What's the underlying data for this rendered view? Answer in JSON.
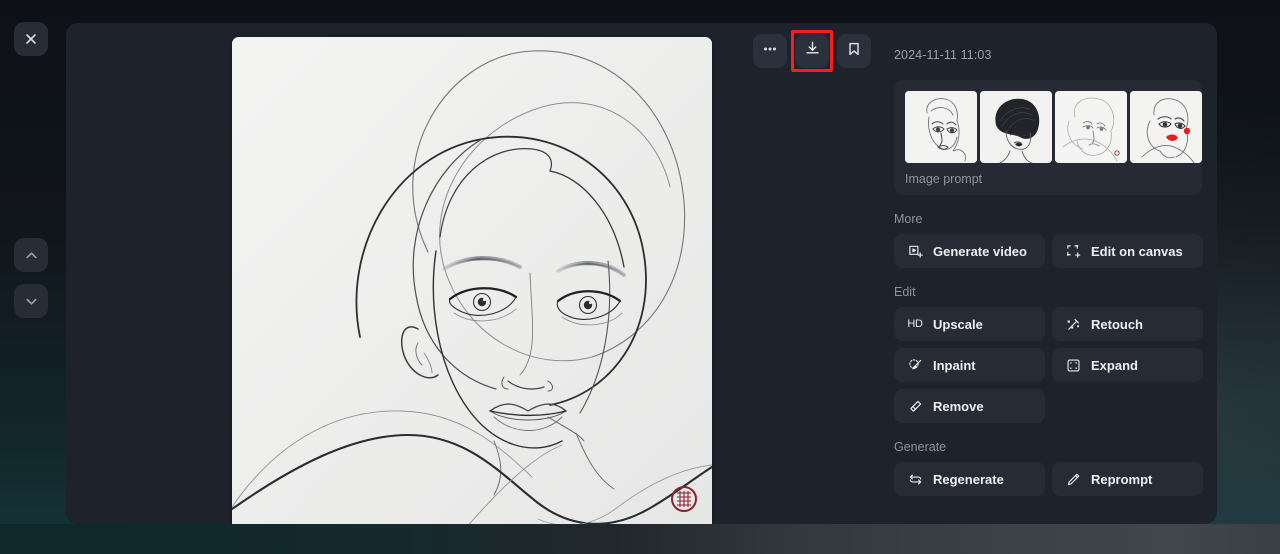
{
  "window": {
    "close_label": "×",
    "background_accent": "#13262a"
  },
  "left_rail": {
    "close_icon": "close-icon",
    "nav_up_icon": "chevron-up-icon",
    "nav_down_icon": "chevron-down-icon"
  },
  "viewer": {
    "toolbar": [
      {
        "name": "more-options-button",
        "icon": "ellipsis-icon",
        "label": "…",
        "highlighted": false
      },
      {
        "name": "download-button",
        "icon": "download-icon",
        "label": "Download",
        "highlighted": true
      },
      {
        "name": "bookmark-button",
        "icon": "bookmark-icon",
        "label": "Bookmark",
        "highlighted": false
      }
    ],
    "highlight_color": "#ff1c1c",
    "image_alt": "Line-art portrait of a woman's face with flowing contour lines and a red seal stamp"
  },
  "sidebar": {
    "timestamp": "2024-11-11 11:03",
    "prompt_card": {
      "caption": "Image prompt",
      "thumbnails": [
        {
          "name": "prompt-thumbnail-1",
          "alt": "line-art female face with wavy hair"
        },
        {
          "name": "prompt-thumbnail-2",
          "alt": "ink portrait with dark updo hair"
        },
        {
          "name": "prompt-thumbnail-3",
          "alt": "faint pencil line portrait"
        },
        {
          "name": "prompt-thumbnail-4",
          "alt": "line portrait with red lips and earring"
        }
      ]
    },
    "sections": [
      {
        "title": "More",
        "buttons": [
          {
            "label": "Generate video",
            "icon": "video-frame-icon"
          },
          {
            "label": "Edit on canvas",
            "icon": "canvas-transform-icon"
          }
        ]
      },
      {
        "title": "Edit",
        "buttons": [
          {
            "label": "Upscale",
            "icon": "hd-icon"
          },
          {
            "label": "Retouch",
            "icon": "magic-wand-icon"
          },
          {
            "label": "Inpaint",
            "icon": "paint-brush-icon"
          },
          {
            "label": "Expand",
            "icon": "expand-frame-icon"
          },
          {
            "label": "Remove",
            "icon": "eraser-icon"
          }
        ]
      },
      {
        "title": "Generate",
        "buttons": [
          {
            "label": "Regenerate",
            "icon": "refresh-arrows-icon"
          },
          {
            "label": "Reprompt",
            "icon": "pencil-icon"
          }
        ]
      }
    ]
  }
}
